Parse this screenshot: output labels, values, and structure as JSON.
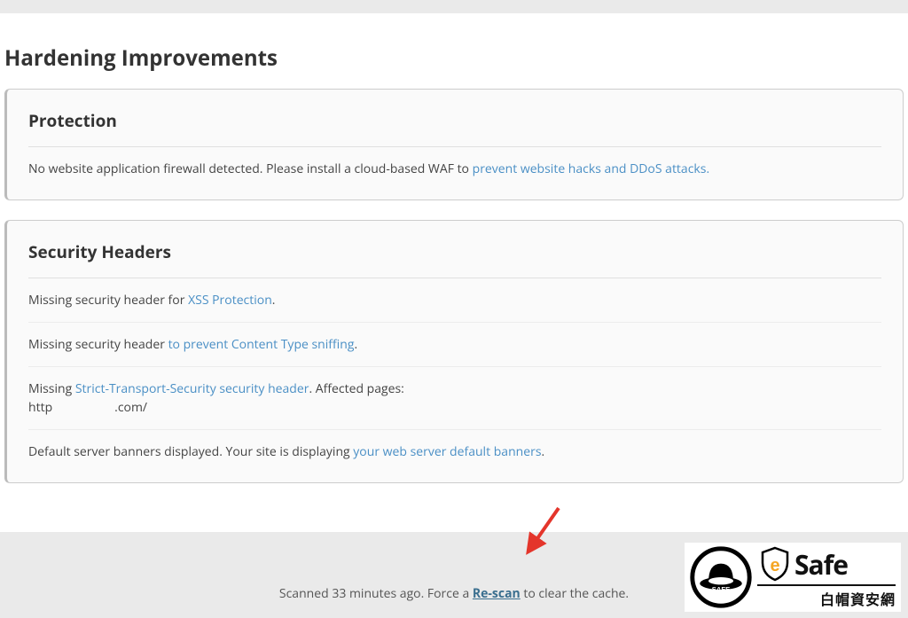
{
  "page": {
    "title": "Hardening Improvements"
  },
  "protection": {
    "title": "Protection",
    "row1_prefix": "No website application firewall detected. Please install a cloud-based WAF to ",
    "row1_link": "prevent website hacks and DDoS attacks."
  },
  "headers": {
    "title": "Security Headers",
    "row1_prefix": "Missing security header for ",
    "row1_link": "XSS Protection",
    "row1_suffix": ".",
    "row2_prefix": "Missing security header ",
    "row2_link": "to prevent Content Type sniffing",
    "row2_suffix": ".",
    "row3_prefix": "Missing ",
    "row3_link": "Strict-Transport-Security security header",
    "row3_suffix": ". Affected pages:",
    "row3_url_prefix": "http",
    "row3_url_suffix": ".com/",
    "row4_prefix": "Default server banners displayed. Your site is displaying ",
    "row4_link": "your web server default banners",
    "row4_suffix": "."
  },
  "footer": {
    "text_before": "Scanned 33 minutes ago. Force a ",
    "rescan": "Re-scan",
    "text_after": " to clear the cache."
  },
  "badge": {
    "safe_label": "SAFE",
    "brand": "Safe",
    "tagline": "白帽資安網"
  }
}
